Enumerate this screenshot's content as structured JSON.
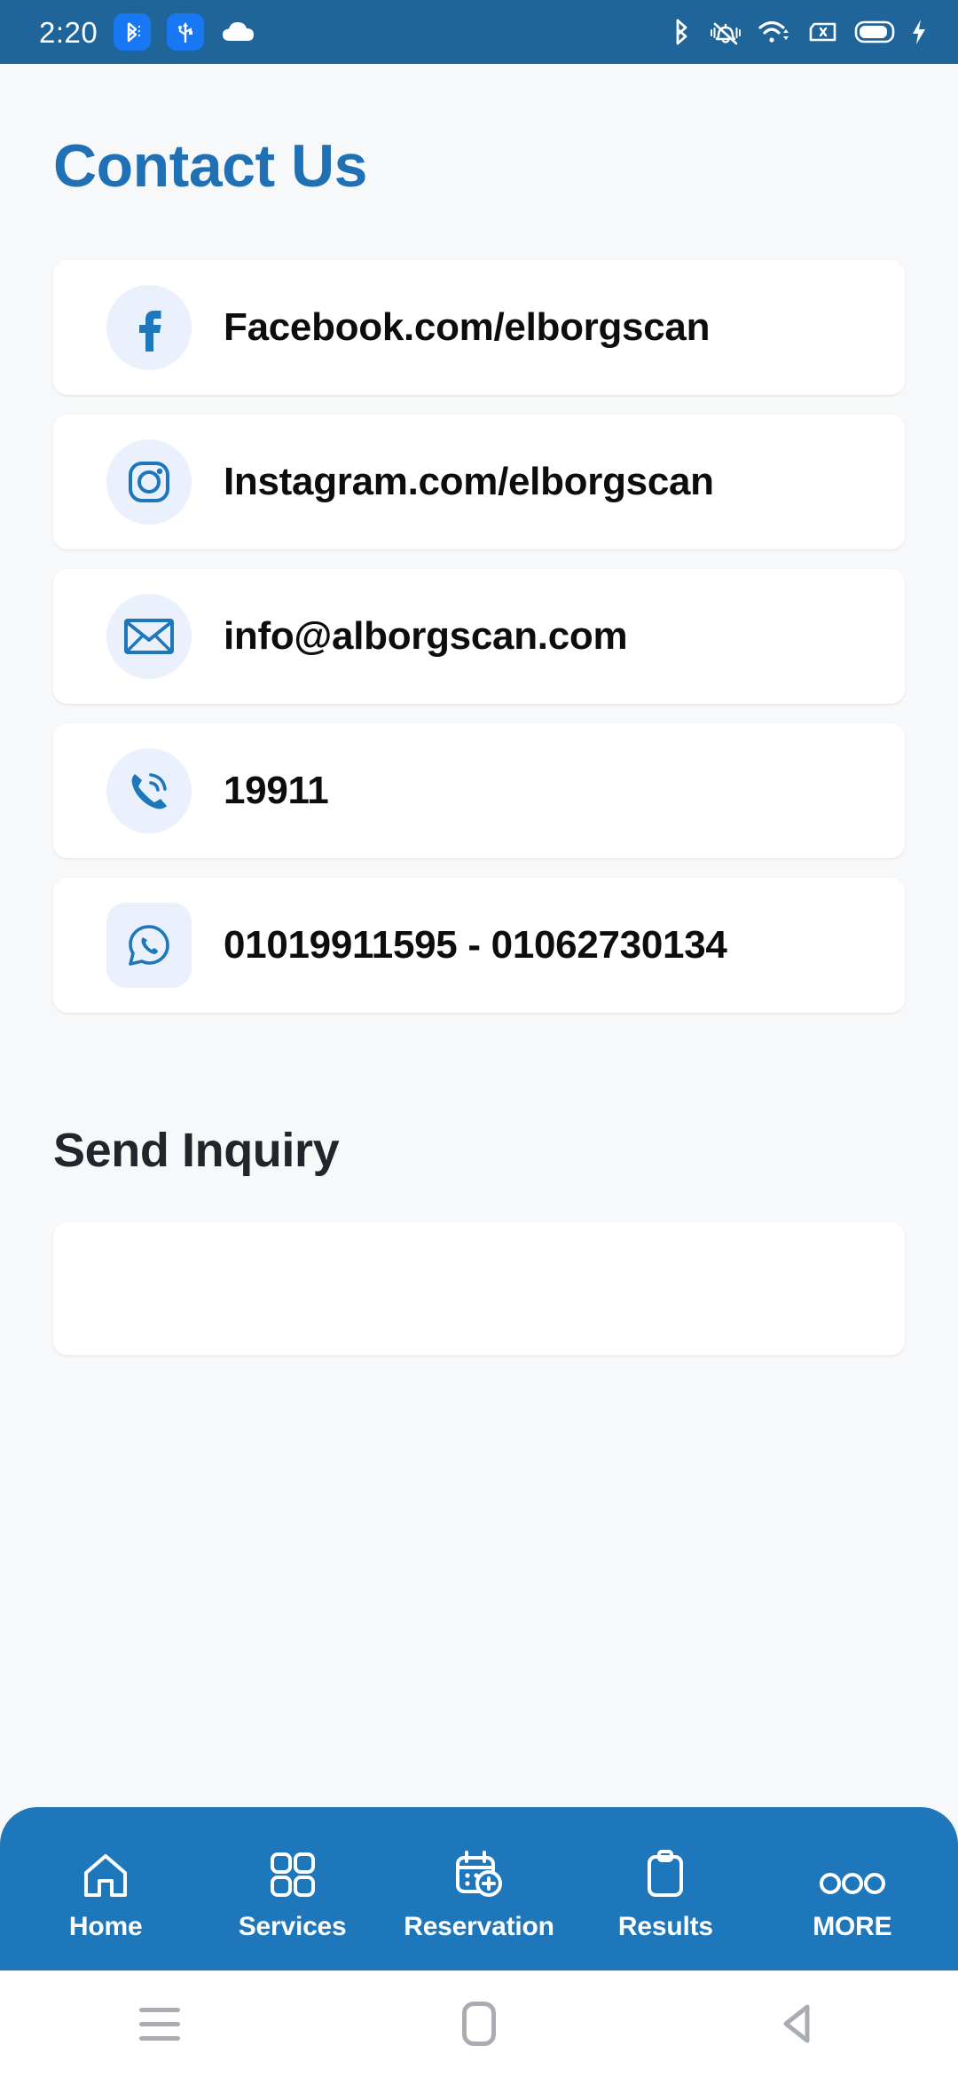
{
  "status_bar": {
    "time": "2:20",
    "left_icons": [
      "bluetooth-chip-icon",
      "usb-chip-icon",
      "cloud-icon"
    ],
    "right_icons": [
      "bluetooth-icon",
      "vibrate-bell-off-icon",
      "wifi-icon",
      "sim-card-off-icon",
      "battery-icon",
      "charging-bolt-icon"
    ]
  },
  "header": {
    "title": "Contact Us",
    "title_color": "#1f70b4"
  },
  "contacts": [
    {
      "icon": "facebook-icon",
      "icon_shape": "circle",
      "label": "Facebook.com/elborgscan"
    },
    {
      "icon": "instagram-icon",
      "icon_shape": "circle",
      "label": "Instagram.com/elborgscan"
    },
    {
      "icon": "email-envelope-icon",
      "icon_shape": "circle",
      "label": "info@alborgscan.com"
    },
    {
      "icon": "phone-call-icon",
      "icon_shape": "circle",
      "label": "19911"
    },
    {
      "icon": "whatsapp-icon",
      "icon_shape": "rounded",
      "label": "01019911595 - 01062730134"
    }
  ],
  "inquiry": {
    "heading": "Send Inquiry",
    "field_value": "",
    "field_placeholder": ""
  },
  "bottom_nav": {
    "background_color": "#1f77bb",
    "items": [
      {
        "icon": "home-icon",
        "label": "Home"
      },
      {
        "icon": "grid-services-icon",
        "label": "Services"
      },
      {
        "icon": "calendar-plus-icon",
        "label": "Reservation"
      },
      {
        "icon": "clipboard-results-icon",
        "label": "Results"
      },
      {
        "icon": "more-dots-icon",
        "label": "MORE"
      }
    ]
  },
  "system_nav": {
    "items": [
      "recents-icon",
      "home-square-icon",
      "back-triangle-icon"
    ]
  }
}
